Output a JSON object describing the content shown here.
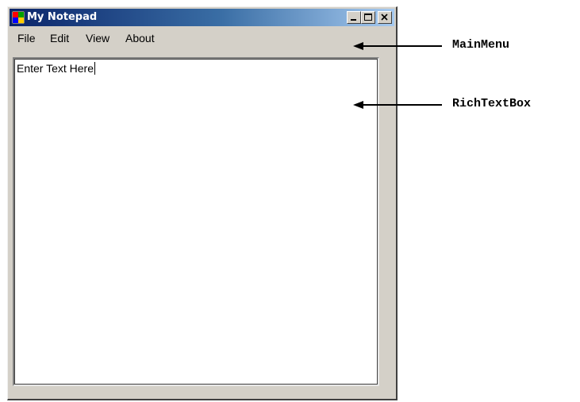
{
  "window": {
    "title": "My Notepad",
    "caption_buttons": [
      {
        "name": "minimize",
        "icon": "minimize-icon"
      },
      {
        "name": "maximize",
        "icon": "maximize-icon"
      },
      {
        "name": "close",
        "icon": "close-icon"
      }
    ]
  },
  "menu": {
    "items": [
      {
        "label": "File"
      },
      {
        "label": "Edit"
      },
      {
        "label": "View"
      },
      {
        "label": "About"
      }
    ]
  },
  "editor": {
    "text": "Enter Text Here"
  },
  "annotations": {
    "main_menu": "MainMenu",
    "rich_text_box": "RichTextBox"
  },
  "colors": {
    "titlebar_start": "#0a246a",
    "titlebar_end": "#a6caf0",
    "window_face": "#d4d0c8"
  }
}
